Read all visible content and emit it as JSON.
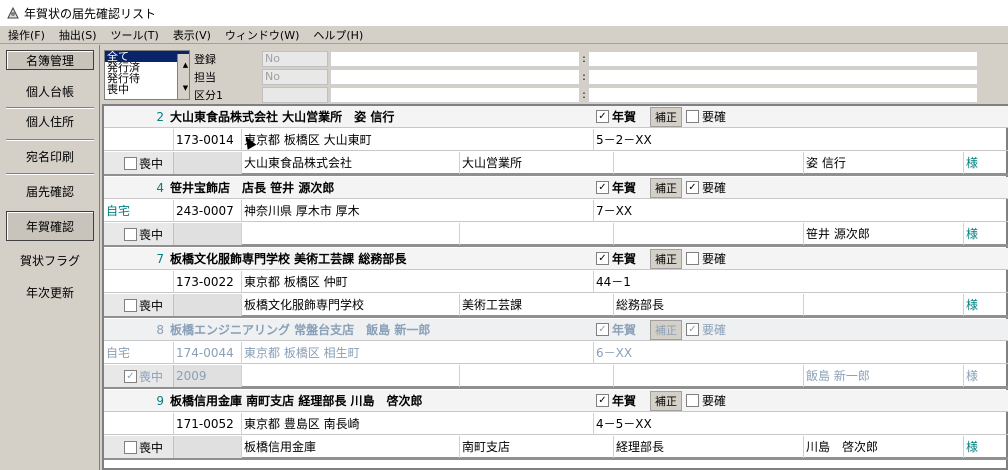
{
  "window": {
    "title": "年賀状の届先確認リスト"
  },
  "menu": [
    "操作(F)",
    "抽出(S)",
    "ツール(T)",
    "表示(V)",
    "ウィンドウ(W)",
    "ヘルプ(H)"
  ],
  "sidebar": {
    "items": [
      {
        "label": "名簿管理"
      },
      {
        "label": "個人台帳"
      },
      {
        "label": "個人住所"
      },
      {
        "label": "宛名印刷"
      },
      {
        "label": "届先確認"
      },
      {
        "label": "年賀確認"
      },
      {
        "label": "賀状フラグ"
      },
      {
        "label": "年次更新"
      }
    ]
  },
  "filter": {
    "list": [
      "全て",
      "発行済",
      "発行待",
      "喪中"
    ],
    "selected": "全て",
    "rows": [
      {
        "label": "登録",
        "value": "No"
      },
      {
        "label": "担当",
        "value": "No"
      },
      {
        "label": "区分1",
        "value": ""
      }
    ],
    "colon": ":"
  },
  "labels": {
    "nenga": "年賀",
    "hosei": "補正",
    "youkaku": "要確",
    "mochu": "喪中",
    "sama": "様"
  },
  "records": [
    {
      "num": "2",
      "name": "大山東食品株式会社 大山営業所　姿 信行",
      "nenga": "✓",
      "youkaku": "",
      "jitaku": "",
      "zip": "173-0014",
      "addr1": "東京都 板橋区 大山東町",
      "addr2": "5－2－XX",
      "mochu": "",
      "year": "",
      "company": "大山東食品株式会社",
      "dept": "大山営業所",
      "title": "",
      "person": "姿 信行"
    },
    {
      "num": "4",
      "name": "笹井宝飾店　店長 笹井 源次郎",
      "nenga": "✓",
      "youkaku": "✓",
      "jitaku": "自宅",
      "zip": "243-0007",
      "addr1": "神奈川県 厚木市 厚木",
      "addr2": "7－XX",
      "mochu": "",
      "year": "",
      "company": "",
      "dept": "",
      "title": "",
      "person": "笹井 源次郎"
    },
    {
      "num": "7",
      "name": "板橋文化服飾専門学校 美術工芸課 総務部長",
      "nenga": "✓",
      "youkaku": "",
      "jitaku": "",
      "zip": "173-0022",
      "addr1": "東京都 板橋区 仲町",
      "addr2": "44－1",
      "mochu": "",
      "year": "",
      "company": "板橋文化服飾専門学校",
      "dept": "美術工芸課",
      "title": "総務部長",
      "person": ""
    },
    {
      "num": "8",
      "name": "板橋エンジニアリング 常盤台支店　飯島 新一郎",
      "nenga": "✓",
      "youkaku": "✓",
      "jitaku": "自宅",
      "zip": "174-0044",
      "addr1": "東京都 板橋区 相生町",
      "addr2": "6－XX",
      "mochu": "✓",
      "year": "2009",
      "company": "",
      "dept": "",
      "title": "",
      "person": "飯島 新一郎"
    },
    {
      "num": "9",
      "name": "板橋信用金庫 南町支店 経理部長 川島　啓次郎",
      "nenga": "✓",
      "youkaku": "",
      "jitaku": "",
      "zip": "171-0052",
      "addr1": "東京都 豊島区 南長崎",
      "addr2": "4－5－XX",
      "mochu": "",
      "year": "",
      "company": "板橋信用金庫",
      "dept": "南町支店",
      "title": "経理部長",
      "person": "川島　啓次郎"
    }
  ],
  "colors": {
    "selection": "#0a246a",
    "teal": "#008080",
    "dimmed": "#8aa0b8"
  }
}
